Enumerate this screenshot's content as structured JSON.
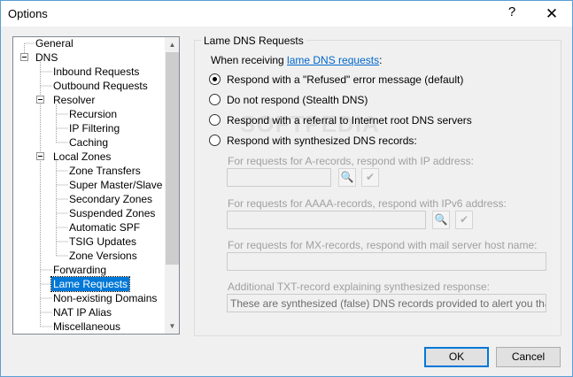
{
  "window": {
    "title": "Options",
    "help_label": "?",
    "close_label": "✕"
  },
  "tree": {
    "items": [
      {
        "label": "General"
      },
      {
        "label": "DNS"
      },
      {
        "label": "Inbound Requests"
      },
      {
        "label": "Outbound Requests"
      },
      {
        "label": "Resolver"
      },
      {
        "label": "Recursion"
      },
      {
        "label": "IP Filtering"
      },
      {
        "label": "Caching"
      },
      {
        "label": "Local Zones"
      },
      {
        "label": "Zone Transfers"
      },
      {
        "label": "Super Master/Slave"
      },
      {
        "label": "Secondary Zones"
      },
      {
        "label": "Suspended Zones"
      },
      {
        "label": "Automatic SPF"
      },
      {
        "label": "TSIG Updates"
      },
      {
        "label": "Zone Versions"
      },
      {
        "label": "Forwarding"
      },
      {
        "label": "Lame Requests"
      },
      {
        "label": "Non-existing Domains"
      },
      {
        "label": "NAT IP Alias"
      },
      {
        "label": "Miscellaneous"
      }
    ],
    "selected": "Lame Requests"
  },
  "group": {
    "title": "Lame DNS Requests",
    "intro_prefix": "When receiving ",
    "intro_link": "lame DNS requests",
    "intro_suffix": ":",
    "options": [
      {
        "label": "Respond with a \"Refused\" error message (default)",
        "checked": true
      },
      {
        "label": "Do not respond (Stealth DNS)",
        "checked": false
      },
      {
        "label": "Respond with a referral to Internet root DNS servers",
        "checked": false
      },
      {
        "label": "Respond with synthesized DNS records:",
        "checked": false
      }
    ],
    "a_label": "For requests for A-records, respond with IP address:",
    "a_value": "",
    "aaaa_label": "For requests for AAAA-records, respond with IPv6 address:",
    "aaaa_value": "",
    "mx_label": "For requests for MX-records, respond with mail server host name:",
    "mx_value": "",
    "txt_label": "Additional TXT-record explaining synthesized response:",
    "txt_value": "These are synthesized (false) DNS records provided to alert you that the rec"
  },
  "buttons": {
    "ok": "OK",
    "cancel": "Cancel"
  },
  "watermark": "SOFTPEDIA"
}
